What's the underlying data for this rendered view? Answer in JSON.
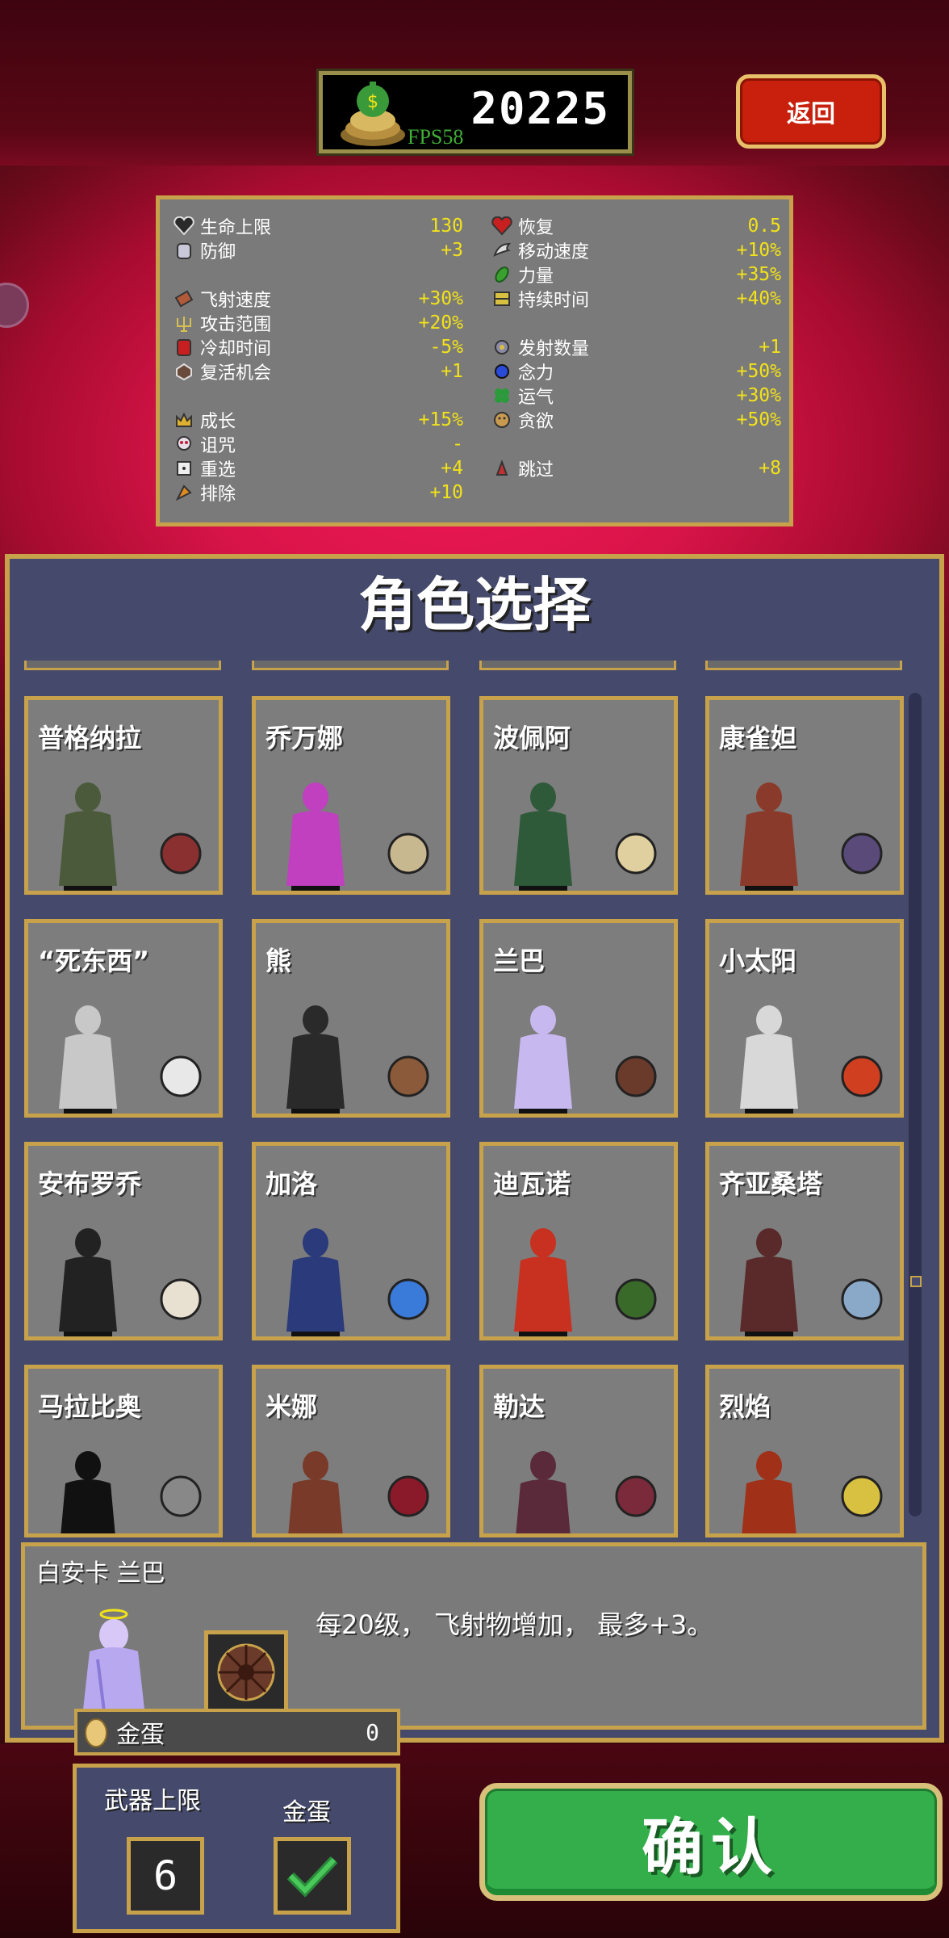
{
  "header": {
    "gold_amount": "20225",
    "fps": "FPS58",
    "back_label": "返回"
  },
  "stats": {
    "left": [
      {
        "icon": "heart-icon",
        "label": "生命上限",
        "value": "130"
      },
      {
        "icon": "armor-icon",
        "label": "防御",
        "value": "+3"
      },
      {
        "icon": "bracer-icon",
        "label": "飞射速度",
        "value": "+30%"
      },
      {
        "icon": "candelabra-icon",
        "label": "攻击范围",
        "value": "+20%"
      },
      {
        "icon": "tome-icon",
        "label": "冷却时间",
        "value": "-5%"
      },
      {
        "icon": "revival-icon",
        "label": "复活机会",
        "value": "+1"
      },
      {
        "icon": "crown-icon",
        "label": "成长",
        "value": "+15%"
      },
      {
        "icon": "skull-icon",
        "label": "诅咒",
        "value": "-"
      },
      {
        "icon": "reroll-icon",
        "label": "重选",
        "value": "+4"
      },
      {
        "icon": "banish-icon",
        "label": "排除",
        "value": "+10"
      }
    ],
    "right": [
      {
        "icon": "recovery-icon",
        "label": "恢复",
        "value": "0.5"
      },
      {
        "icon": "wings-icon",
        "label": "移动速度",
        "value": "+10%"
      },
      {
        "icon": "spinach-icon",
        "label": "力量",
        "value": "+35%"
      },
      {
        "icon": "spellbinder-icon",
        "label": "持续时间",
        "value": "+40%"
      },
      {
        "icon": "duplicator-icon",
        "label": "发射数量",
        "value": "+1"
      },
      {
        "icon": "attractorb-icon",
        "label": "念力",
        "value": "+50%"
      },
      {
        "icon": "clover-icon",
        "label": "运气",
        "value": "+30%"
      },
      {
        "icon": "greed-icon",
        "label": "贪欲",
        "value": "+50%"
      },
      {
        "icon": "skip-icon",
        "label": "跳过",
        "value": "+8"
      }
    ]
  },
  "panel": {
    "title": "角色选择"
  },
  "characters": [
    {
      "name": "普格纳拉",
      "char_color": "#4a5a3a",
      "item_color": "#8a3030"
    },
    {
      "name": "乔万娜",
      "char_color": "#c040c0",
      "item_color": "#c8b890"
    },
    {
      "name": "波佩阿",
      "char_color": "#2e5a3a",
      "item_color": "#e0d0a0"
    },
    {
      "name": "康雀妲",
      "char_color": "#8a3a2a",
      "item_color": "#5a4a7a"
    },
    {
      "name": "“死东西”",
      "char_color": "#c8c8c8",
      "item_color": "#e8e8e8"
    },
    {
      "name": "熊",
      "char_color": "#2a2a2a",
      "item_color": "#8a5a3a"
    },
    {
      "name": "兰巴",
      "char_color": "#c8b8f0",
      "item_color": "#6a3a2a"
    },
    {
      "name": "小太阳",
      "char_color": "#d8d8d8",
      "item_color": "#d04020"
    },
    {
      "name": "安布罗乔",
      "char_color": "#222222",
      "item_color": "#e8e0d0"
    },
    {
      "name": "加洛",
      "char_color": "#2a3a7a",
      "item_color": "#3a7ad8"
    },
    {
      "name": "迪瓦诺",
      "char_color": "#c83020",
      "item_color": "#3a6a2a"
    },
    {
      "name": "齐亚桑塔",
      "char_color": "#5a2a2a",
      "item_color": "#8aa8c8"
    },
    {
      "name": "马拉比奥",
      "char_color": "#111111",
      "item_color": "#888888"
    },
    {
      "name": "米娜",
      "char_color": "#7a3a2a",
      "item_color": "#8a1a2a"
    },
    {
      "name": "勒达",
      "char_color": "#5a2a3a",
      "item_color": "#7a2a3a"
    },
    {
      "name": "烈焰",
      "char_color": "#a03018",
      "item_color": "#d8c040"
    }
  ],
  "selected": {
    "name": "白安卡 兰巴",
    "description": "每20级， 飞射物增加， 最多+3。"
  },
  "golden_egg": {
    "label": "金蛋",
    "count": "0"
  },
  "options": {
    "weapon_limit_label": "武器上限",
    "weapon_limit_value": "6",
    "golden_egg_label": "金蛋",
    "golden_egg_enabled": true
  },
  "confirm_label": "确认",
  "colors": {
    "panel_border": "#c8a24a",
    "stat_value": "#f2e21a",
    "confirm_green": "#33ae4a",
    "back_red": "#c8200c"
  }
}
